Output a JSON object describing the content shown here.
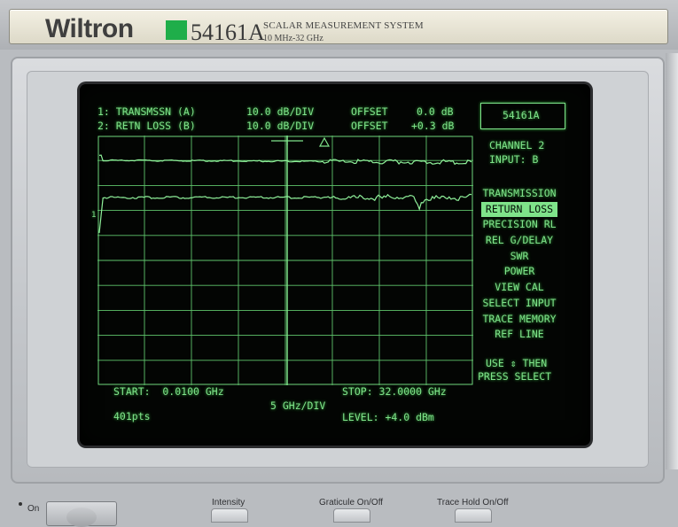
{
  "brand": {
    "name": "Wiltron",
    "model": "54161A",
    "system_title": "SCALAR MEASUREMENT SYSTEM",
    "frequency_range": "10 MHz-32 GHz",
    "accent_color": "#1fae4a"
  },
  "screen": {
    "channels": [
      {
        "label": "1: TRANSMSSN (A)",
        "scale": "10.0 dB/DIV",
        "offset_label": "OFFSET",
        "offset_value": "0.0 dB"
      },
      {
        "label": "2: RETN LOSS (B)",
        "scale": "10.0 dB/DIV",
        "offset_label": "OFFSET",
        "offset_value": "+0.3 dB"
      }
    ],
    "model_box": "54161A",
    "channel_info": {
      "line1": "CHANNEL 2",
      "line2": "INPUT: B"
    },
    "menu": [
      {
        "label": "TRANSMISSION",
        "selected": false
      },
      {
        "label": "RETURN LOSS",
        "selected": true
      },
      {
        "label": "PRECISION RL",
        "selected": false
      },
      {
        "label": "REL G/DELAY",
        "selected": false
      },
      {
        "label": "SWR",
        "selected": false
      },
      {
        "label": "POWER",
        "selected": false
      },
      {
        "label": "VIEW CAL",
        "selected": false
      },
      {
        "label": "SELECT INPUT",
        "selected": false
      },
      {
        "label": "TRACE MEMORY",
        "selected": false
      },
      {
        "label": "REF LINE",
        "selected": false
      }
    ],
    "hint": {
      "line1": "USE ⇕ THEN",
      "line2": "PRESS SELECT"
    },
    "start": "START:  0.0100 GHz",
    "stop": "STOP: 32.0000 GHz",
    "freq_scale": "5 GHz/DIV",
    "points": "401pts",
    "level": "LEVEL: +4.0 dBm",
    "ref_marker": "1",
    "phosphor_color": "#7fe38a"
  },
  "controls": {
    "power_label": "On",
    "intensity_label": "Intensity",
    "graticule_label": "Graticule On/Off",
    "trace_hold_label": "Trace Hold On/Off"
  }
}
